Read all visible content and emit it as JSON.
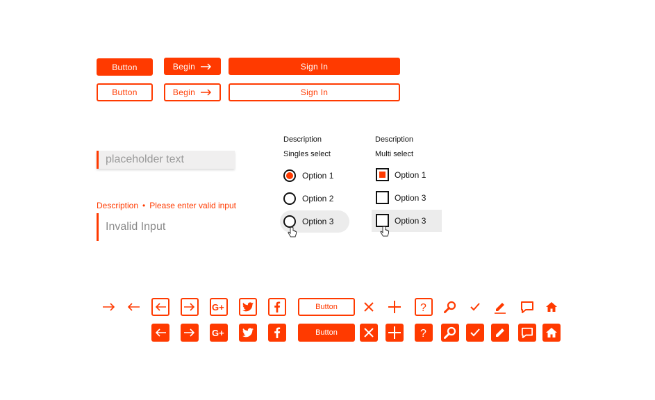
{
  "colors": {
    "accent": "#ff3a00"
  },
  "buttons": {
    "button": "Button",
    "begin": "Begin",
    "sign_in": "Sign In"
  },
  "inputs": {
    "placeholder": "placeholder text",
    "error_description": "Description",
    "error_separator": "•",
    "error_message": "Please enter valid input",
    "invalid_value": "Invalid Input"
  },
  "singles": {
    "description": "Description",
    "title": "Singles select",
    "options": [
      "Option 1",
      "Option 2",
      "Option 3"
    ]
  },
  "multi": {
    "description": "Description",
    "title": "Multi select",
    "options": [
      "Option 1",
      "Option 3",
      "Option 3"
    ]
  },
  "icons": {
    "row1": [
      "arrow-right-icon",
      "arrow-left-icon",
      "arrow-left-boxed-icon",
      "arrow-right-boxed-icon",
      "google-plus-icon",
      "twitter-icon",
      "facebook-icon",
      "button",
      "close-icon",
      "plus-icon",
      "help-icon",
      "search-icon",
      "check-icon",
      "edit-icon",
      "comment-icon",
      "home-icon"
    ],
    "button_label": "Button"
  }
}
